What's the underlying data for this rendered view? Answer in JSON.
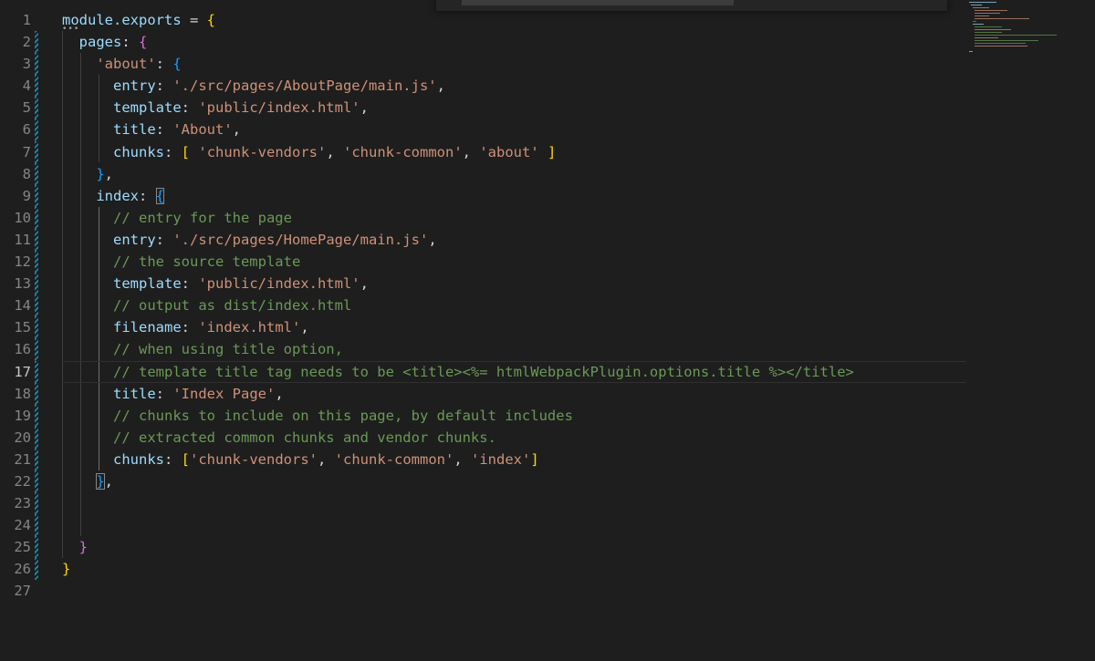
{
  "gutter": {
    "line_numbers": [
      "1",
      "2",
      "3",
      "4",
      "5",
      "6",
      "7",
      "8",
      "9",
      "10",
      "11",
      "12",
      "13",
      "14",
      "15",
      "16",
      "17",
      "18",
      "19",
      "20",
      "21",
      "22",
      "23",
      "24",
      "25",
      "26",
      "27"
    ],
    "active_line": "17"
  },
  "code": {
    "l1": [
      "module",
      ".exports",
      " = ",
      "{"
    ],
    "l2": [
      "  ",
      "pages",
      ": ",
      "{"
    ],
    "l3": [
      "    ",
      "'about'",
      ": ",
      "{"
    ],
    "l4": [
      "      ",
      "entry",
      ": ",
      "'./src/pages/AboutPage/main.js'",
      ","
    ],
    "l5": [
      "      ",
      "template",
      ": ",
      "'public/index.html'",
      ","
    ],
    "l6": [
      "      ",
      "title",
      ": ",
      "'About'",
      ","
    ],
    "l7": [
      "      ",
      "chunks",
      ": ",
      "[",
      " ",
      "'chunk-vendors'",
      ", ",
      "'chunk-common'",
      ", ",
      "'about'",
      " ",
      "]"
    ],
    "l8": [
      "    ",
      "}",
      ","
    ],
    "l9": [
      "    ",
      "index",
      ": ",
      "{"
    ],
    "l10": [
      "      ",
      "// entry for the page"
    ],
    "l11": [
      "      ",
      "entry",
      ": ",
      "'./src/pages/HomePage/main.js'",
      ","
    ],
    "l12": [
      "      ",
      "// the source template"
    ],
    "l13": [
      "      ",
      "template",
      ": ",
      "'public/index.html'",
      ","
    ],
    "l14": [
      "      ",
      "// output as dist/index.html"
    ],
    "l15": [
      "      ",
      "filename",
      ": ",
      "'index.html'",
      ","
    ],
    "l16": [
      "      ",
      "// when using title option,"
    ],
    "l17": [
      "      ",
      "// template title tag needs to be <title><%= htmlWebpackPlugin.options.title %></title>"
    ],
    "l18": [
      "      ",
      "title",
      ": ",
      "'Index Page'",
      ","
    ],
    "l19": [
      "      ",
      "// chunks to include on this page, by default includes"
    ],
    "l20": [
      "      ",
      "// extracted common chunks and vendor chunks."
    ],
    "l21": [
      "      ",
      "chunks",
      ": ",
      "[",
      "'chunk-vendors'",
      ", ",
      "'chunk-common'",
      ", ",
      "'index'",
      "]"
    ],
    "l22": [
      "    ",
      "}",
      ","
    ],
    "l25": [
      "  ",
      "}"
    ],
    "l26": [
      "",
      "}"
    ]
  },
  "colors": {
    "background": "#1e1e1e",
    "property": "#9cdcfe",
    "string": "#ce9178",
    "comment": "#6a9955",
    "bracket_gold": "#ffd700",
    "bracket_orchid": "#da70d6",
    "bracket_blue": "#179fff",
    "line_number": "#858585"
  }
}
